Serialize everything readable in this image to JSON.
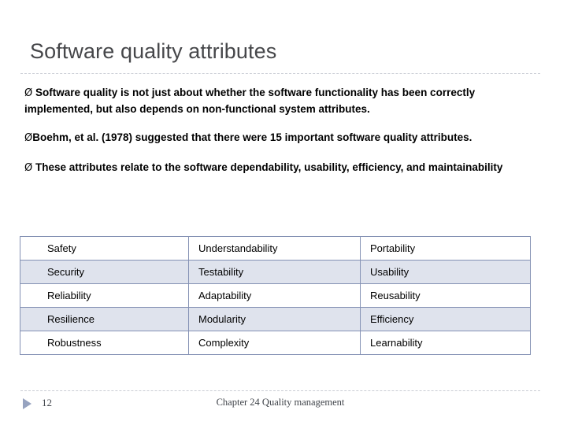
{
  "slide": {
    "title": "Software quality attributes",
    "bullets": [
      {
        "marker": "Ø",
        "spacer": "  ",
        "text": "Software quality is not just about whether the software functionality has been correctly implemented, but also depends on non-functional system attributes."
      },
      {
        "marker": "Ø",
        "spacer": "",
        "text": "Boehm, et al. (1978) suggested that there were 15 important software quality attributes."
      },
      {
        "marker": "Ø",
        "spacer": "  ",
        "text": "These attributes relate to the software dependability, usability, efficiency, and maintainability"
      }
    ],
    "table": {
      "rows": [
        {
          "banded": false,
          "cells": [
            "Safety",
            "Understandability",
            "Portability"
          ]
        },
        {
          "banded": true,
          "cells": [
            "Security",
            "Testability",
            "Usability"
          ]
        },
        {
          "banded": false,
          "cells": [
            "Reliability",
            "Adaptability",
            "Reusability"
          ]
        },
        {
          "banded": true,
          "cells": [
            "Resilience",
            "Modularity",
            "Efficiency"
          ]
        },
        {
          "banded": false,
          "cells": [
            "Robustness",
            "Complexity",
            "Learnability"
          ]
        }
      ]
    },
    "footer": {
      "slide_number": "12",
      "center_text": "Chapter 24 Quality management",
      "marker_icon": "triangle-right-icon"
    },
    "colors": {
      "title": "#46474a",
      "rule": "#c9ccd4",
      "table_border": "#8491b4",
      "table_band": "#dfe3ed",
      "footer_triangle": "#97a3c0",
      "background": "#ffffff"
    }
  }
}
